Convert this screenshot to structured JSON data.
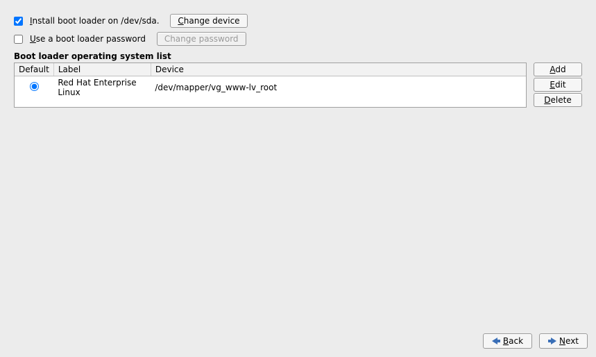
{
  "install": {
    "checked": true,
    "label_before_mnemonic": "",
    "mnemonic": "I",
    "label_after_mnemonic": "nstall boot loader on /dev/sda.",
    "change_device_mnemonic": "C",
    "change_device_rest": "hange device"
  },
  "password": {
    "checked": false,
    "mnemonic": "U",
    "label_rest": "se a boot loader password",
    "change_password_label": "Change password"
  },
  "list": {
    "title": "Boot loader operating system list",
    "headers": {
      "default": "Default",
      "label": "Label",
      "device": "Device"
    },
    "rows": [
      {
        "default": true,
        "label": "Red Hat Enterprise Linux",
        "device": "/dev/mapper/vg_www-lv_root"
      }
    ],
    "buttons": {
      "add_m": "A",
      "add_r": "dd",
      "edit_m": "E",
      "edit_r": "dit",
      "delete_m": "D",
      "delete_r": "elete"
    }
  },
  "footer": {
    "back_m": "B",
    "back_r": "ack",
    "next_m": "N",
    "next_r": "ext"
  }
}
